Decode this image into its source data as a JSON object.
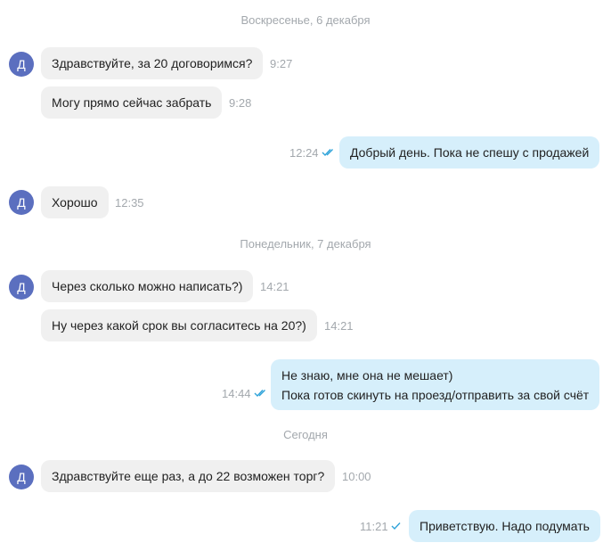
{
  "dates": [
    "Воскресенье, 6 декабря",
    "Понедельник, 7 декабря",
    "Сегодня"
  ],
  "avatar_letter": "Д",
  "messages": [
    {
      "text": "Здравствуйте, за 20 договоримся?",
      "time": "9:27"
    },
    {
      "text": "Могу прямо сейчас забрать",
      "time": "9:28"
    },
    {
      "text": "Добрый день. Пока не спешу с продажей",
      "time": "12:24",
      "status": "read"
    },
    {
      "text": "Хорошо",
      "time": "12:35"
    },
    {
      "text": "Через сколько можно написать?)",
      "time": "14:21"
    },
    {
      "text": "Ну через какой срок вы согласитесь на 20?)",
      "time": "14:21"
    },
    {
      "lines": [
        "Не знаю, мне она не мешает)",
        "Пока готов скинуть на проезд/отправить за свой счёт"
      ],
      "time": "14:44",
      "status": "read"
    },
    {
      "text": "Здравствуйте еще раз, а до 22 возможен торг?",
      "time": "10:00"
    },
    {
      "text": "Приветствую. Надо подумать",
      "time": "11:21",
      "status": "delivered"
    }
  ],
  "colors": {
    "incoming_bg": "#f0f0f0",
    "outgoing_bg": "#d6effb",
    "avatar_bg": "#5b6fbf",
    "check": "#2fa3d9",
    "meta_text": "#a3a8ad"
  }
}
